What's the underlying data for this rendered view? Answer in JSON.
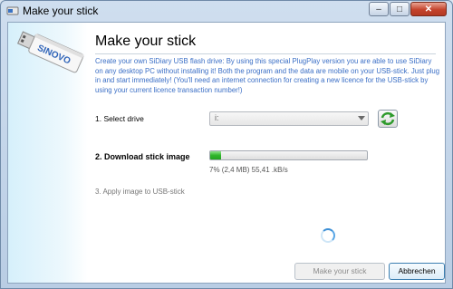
{
  "window": {
    "title": "Make your stick"
  },
  "brand": {
    "stick_text": "SINOVO"
  },
  "header": {
    "title": "Make your stick"
  },
  "description": "Create your own SiDiary USB flash drive: By using this special PlugPlay version you are able to use SiDiary on any desktop PC without installing it! Both the program and the data are mobile on your USB-stick. Just plug in and start immediately! (You'll need an internet connection for creating a new licence for the USB-stick by using your current licence transaction number!)",
  "steps": {
    "select_drive": {
      "label": "1. Select drive",
      "value": "i:"
    },
    "download": {
      "label": "2. Download stick image",
      "progress_percent": 7,
      "progress_text": "7% (2,4 MB) 55,41 .kB/s"
    },
    "apply": {
      "label": "3. Apply image to USB-stick"
    }
  },
  "buttons": {
    "create": "Make your stick",
    "cancel": "Abbrechen"
  },
  "colors": {
    "accent": "#3b6fc6",
    "progress": "#2fb52a"
  },
  "icons": {
    "refresh": "refresh-icon",
    "spinner": "loading-spinner-icon"
  }
}
